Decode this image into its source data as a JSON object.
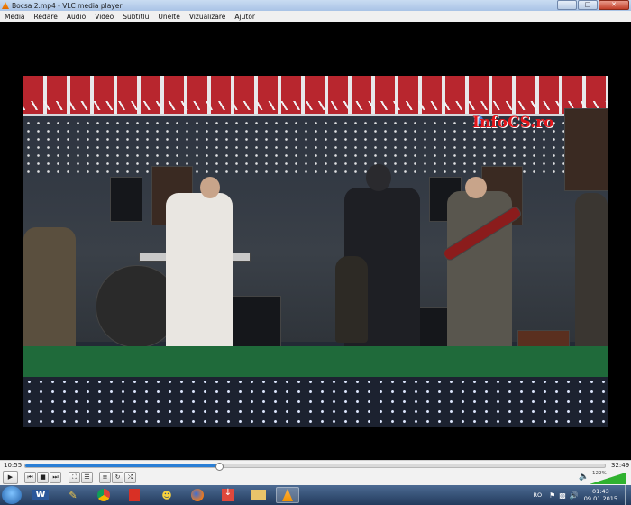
{
  "window": {
    "title": "Bocsa 2.mp4 - VLC media player"
  },
  "menu": [
    "Media",
    "Redare",
    "Audio",
    "Video",
    "Subtitlu",
    "Unelte",
    "Vizualizare",
    "Ajutor"
  ],
  "video": {
    "watermark": "InfoCS.ro"
  },
  "player": {
    "elapsed": "10:55",
    "duration": "32:49",
    "progress_fraction": 0.333,
    "volume_label": "122%",
    "volume_fraction": 1.0
  },
  "taskbar": {
    "language": "RO",
    "time": "01:43",
    "date": "09.01.2015",
    "apps": [
      "word-icon",
      "pencil-icon",
      "chrome-icon",
      "pdf-icon",
      "messenger-icon",
      "firefox-icon",
      "download-icon",
      "folder-icon",
      "vlc-icon"
    ]
  },
  "colors": {
    "accent": "#2a7fd6",
    "vlc_orange": "#f39200",
    "watermark": "#e2171c"
  }
}
